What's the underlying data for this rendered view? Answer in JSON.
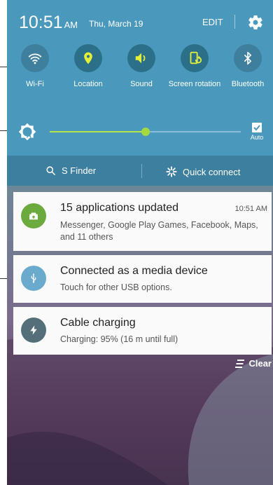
{
  "status": {
    "time": "10:51",
    "ampm": "AM",
    "date": "Thu, March 19",
    "edit_label": "EDIT"
  },
  "quick_settings": [
    {
      "label": "Wi-Fi",
      "icon": "wifi-icon",
      "state": "off"
    },
    {
      "label": "Location",
      "icon": "location-pin-icon",
      "state": "on"
    },
    {
      "label": "Sound",
      "icon": "speaker-icon",
      "state": "on"
    },
    {
      "label": "Screen rotation",
      "icon": "screen-rotation-icon",
      "state": "on"
    },
    {
      "label": "Bluetooth",
      "icon": "bluetooth-icon",
      "state": "off"
    }
  ],
  "brightness": {
    "level": 0.5,
    "auto_label": "Auto"
  },
  "finder_bar": {
    "s_finder_label": "S Finder",
    "quick_connect_label": "Quick connect"
  },
  "notifications": [
    {
      "title": "15 applications updated",
      "time": "10:51 AM",
      "body": "Messenger, Google Play Games, Facebook, Maps, and 11 others",
      "icon": "app-update-icon",
      "icon_color": "#6bab3e"
    },
    {
      "title": "Connected as a media device",
      "body": "Touch for other USB options.",
      "icon": "usb-icon",
      "icon_color": "#6aabcd"
    },
    {
      "title": "Cable charging",
      "body": "Charging: 95% (16 m until full)",
      "icon": "charging-bolt-icon",
      "icon_color": "#546e7a"
    }
  ],
  "clear_label": "Clear",
  "colors": {
    "panel": "#4a99bd",
    "toggle_on": "#2b7088",
    "slider": "#a6d93d"
  }
}
